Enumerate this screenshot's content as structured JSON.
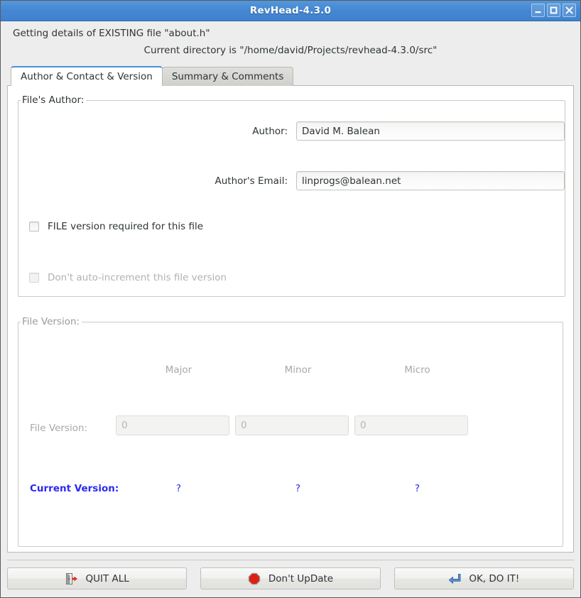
{
  "window": {
    "title": "RevHead-4.3.0",
    "controls": [
      {
        "name": "minimize",
        "glyph": "minimize-icon"
      },
      {
        "name": "maximize",
        "glyph": "maximize-icon"
      },
      {
        "name": "close",
        "glyph": "close-icon"
      }
    ]
  },
  "header": {
    "status_line": "Getting details of EXISTING file \"about.h\"",
    "directory_line": "Current directory is \"/home/david/Projects/revhead-4.3.0/src\""
  },
  "tabs": [
    {
      "label": "Author & Contact & Version",
      "active": true
    },
    {
      "label": "Summary & Comments",
      "active": false
    }
  ],
  "author_section": {
    "legend": "File's Author:",
    "author": {
      "label": "Author:",
      "value": "David M. Balean",
      "placeholder": ""
    },
    "email": {
      "label": "Author's Email:",
      "value": "linprogs@balean.net",
      "placeholder": ""
    },
    "checkboxes": [
      {
        "label": "FILE version required for this file",
        "checked": false,
        "enabled": true
      },
      {
        "label": "Don't auto-increment this file version",
        "checked": false,
        "enabled": false
      }
    ]
  },
  "version_section": {
    "legend": "File Version:",
    "columns": [
      "Major",
      "Minor",
      "Micro"
    ],
    "file_version": {
      "label": "File Version:",
      "values": [
        "0",
        "0",
        "0"
      ],
      "enabled": false
    },
    "current_version": {
      "label": "Current Version:",
      "values": [
        "?",
        "?",
        "?"
      ],
      "color": "#2a2af0"
    }
  },
  "actions": [
    {
      "label": "QUIT ALL",
      "icon": "exit-door-icon"
    },
    {
      "label": "Don't UpDate",
      "icon": "stop-sign-icon"
    },
    {
      "label": "OK, DO IT!",
      "icon": "enter-arrow-icon"
    }
  ],
  "colors": {
    "titlebar": "#4487d2",
    "accent_blue": "#4a90d9",
    "current_version_text": "#2a2af0",
    "window_bg": "#ededed",
    "panel_bg": "#ffffff"
  }
}
